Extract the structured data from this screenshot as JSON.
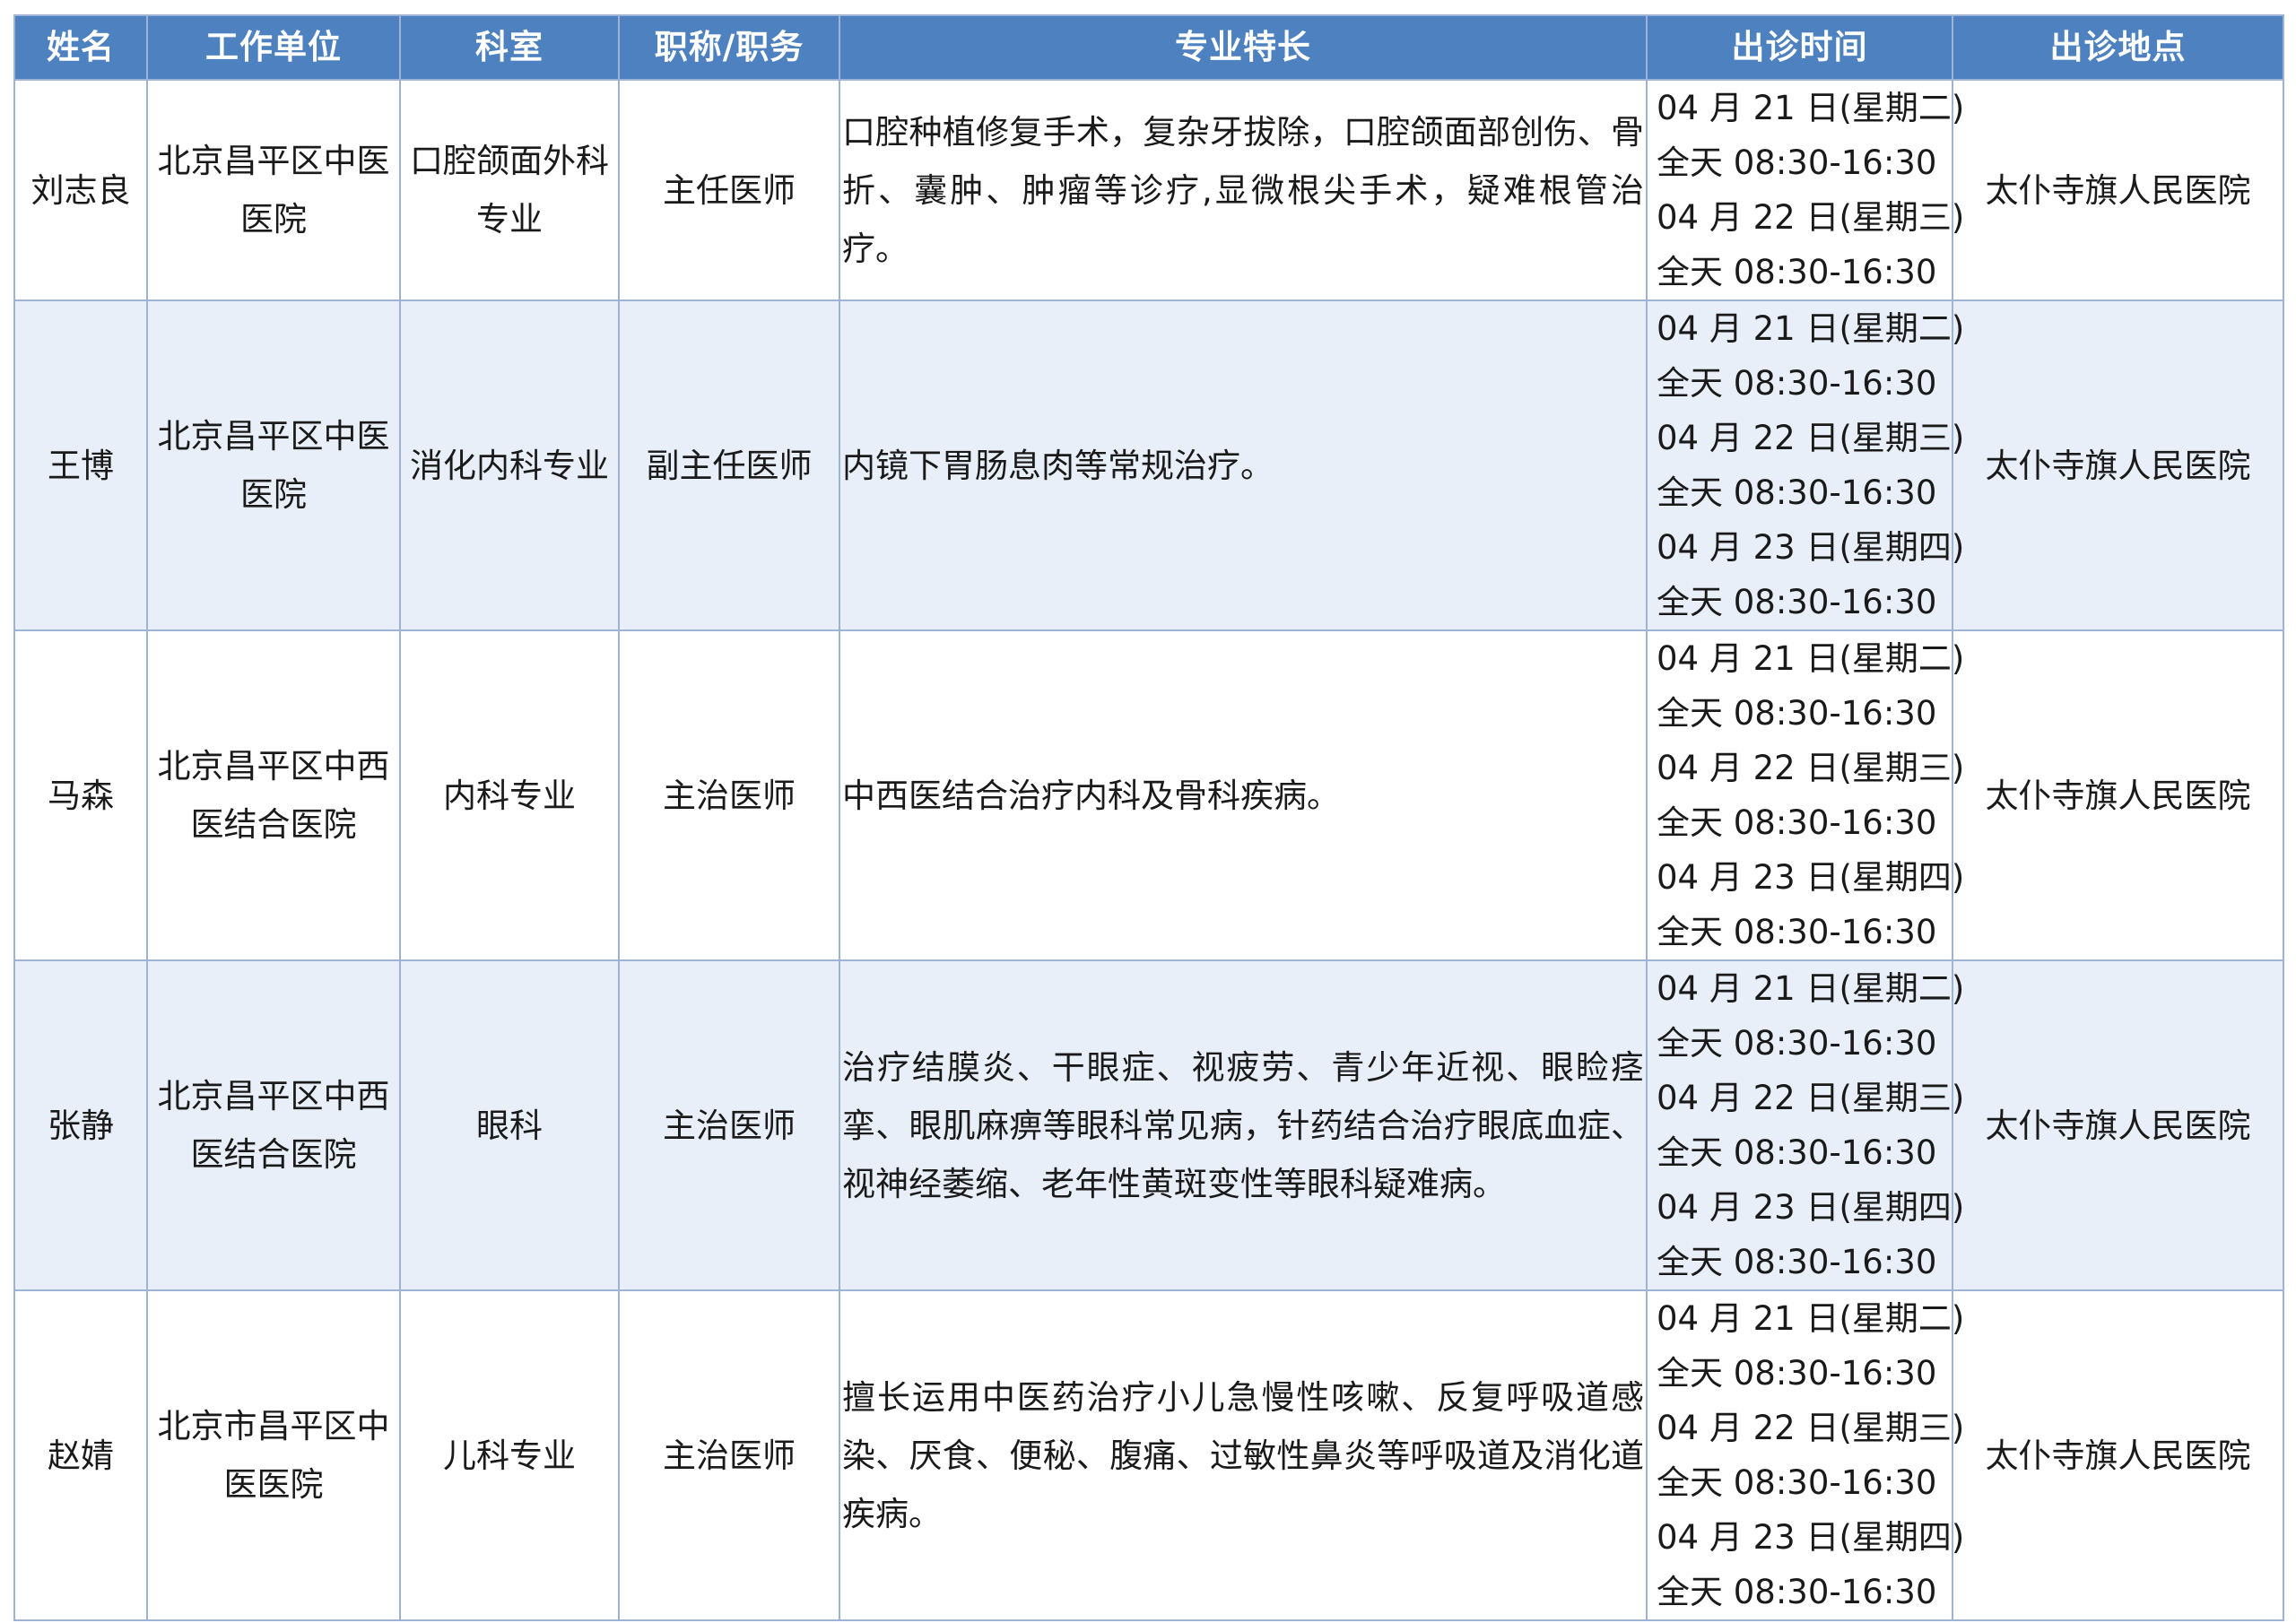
{
  "columns": {
    "name": "姓名",
    "unit": "工作单位",
    "dept": "科室",
    "title": "职称/职务",
    "specialty": "专业特长",
    "time": "出诊时间",
    "place": "出诊地点"
  },
  "doctors": [
    {
      "name": "刘志良",
      "unit": "北京昌平区中医医院",
      "dept": "口腔颌面外科专业",
      "title": "主任医师",
      "specialty": "口腔种植修复手术，复杂牙拔除，口腔颌面部创伤、骨折、囊肿、肿瘤等诊疗,显微根尖手术，疑难根管治疗。",
      "times": [
        "04 月 21 日(星期二)",
        "全天 08:30-16:30",
        "04 月 22 日(星期三)",
        "全天 08:30-16:30"
      ],
      "place": "太仆寺旗人民医院"
    },
    {
      "name": "王博",
      "unit": "北京昌平区中医医院",
      "dept": "消化内科专业",
      "title": "副主任医师",
      "specialty": "内镜下胃肠息肉等常规治疗。",
      "times": [
        "04 月 21 日(星期二)",
        "全天 08:30-16:30",
        "04 月 22 日(星期三)",
        "全天 08:30-16:30",
        "04 月 23 日(星期四)",
        "全天 08:30-16:30"
      ],
      "place": "太仆寺旗人民医院"
    },
    {
      "name": "马森",
      "unit": "北京昌平区中西医结合医院",
      "dept": "内科专业",
      "title": "主治医师",
      "specialty": "中西医结合治疗内科及骨科疾病。",
      "times": [
        "04 月 21 日(星期二)",
        "全天 08:30-16:30",
        "04 月 22 日(星期三)",
        "全天 08:30-16:30",
        "04 月 23 日(星期四)",
        "全天 08:30-16:30"
      ],
      "place": "太仆寺旗人民医院"
    },
    {
      "name": "张静",
      "unit": "北京昌平区中西医结合医院",
      "dept": "眼科",
      "title": "主治医师",
      "specialty": "治疗结膜炎、干眼症、视疲劳、青少年近视、眼睑痉挛、眼肌麻痹等眼科常见病，针药结合治疗眼底血症、视神经萎缩、老年性黄斑变性等眼科疑难病。",
      "times": [
        "04 月 21 日(星期二)",
        "全天 08:30-16:30",
        "04 月 22 日(星期三)",
        "全天 08:30-16:30",
        "04 月 23 日(星期四)",
        "全天 08:30-16:30"
      ],
      "place": "太仆寺旗人民医院"
    },
    {
      "name": "赵婧",
      "unit": "北京市昌平区中医医院",
      "dept": "儿科专业",
      "title": "主治医师",
      "specialty": "擅长运用中医药治疗小儿急慢性咳嗽、反复呼吸道感染、厌食、便秘、腹痛、过敏性鼻炎等呼吸道及消化道疾病。",
      "times": [
        "04 月 21 日(星期二)",
        "全天 08:30-16:30",
        "04 月 22 日(星期三)",
        "全天 08:30-16:30",
        "04 月 23 日(星期四)",
        "全天 08:30-16:30"
      ],
      "place": "太仆寺旗人民医院"
    }
  ]
}
